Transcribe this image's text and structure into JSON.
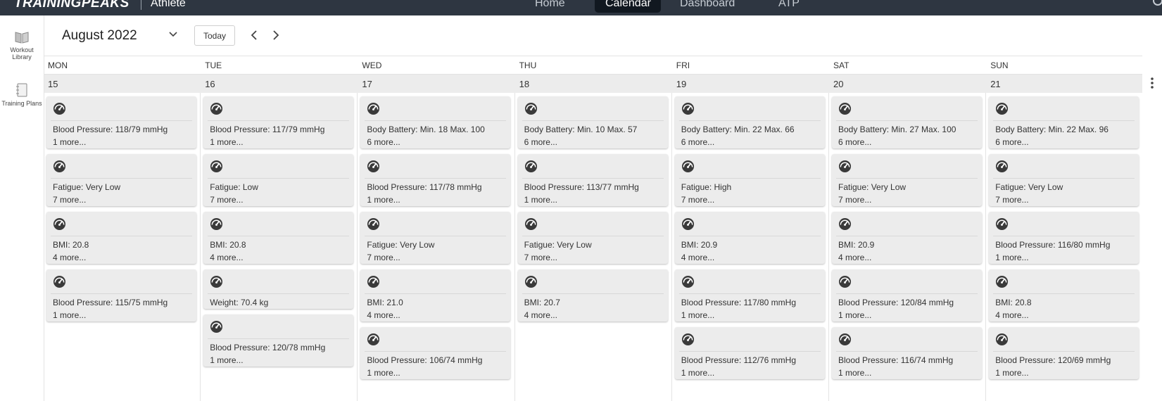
{
  "topnav": {
    "logo": "TRAININGPEAKS",
    "role": "Athlete",
    "items": [
      "Home",
      "Calendar",
      "Dashboard",
      "ATP"
    ],
    "active": "Calendar"
  },
  "rail": {
    "workout_library": "Workout Library",
    "training_plans": "Training Plans"
  },
  "toolbar": {
    "month": "August 2022",
    "today_label": "Today"
  },
  "calendar": {
    "days": [
      {
        "name": "MON",
        "date": "15",
        "cards": [
          {
            "title": "Blood Pressure: 118/79 mmHg",
            "more": "1 more..."
          },
          {
            "title": "Fatigue: Very Low",
            "more": "7 more..."
          },
          {
            "title": "BMI: 20.8",
            "more": "4 more..."
          },
          {
            "title": "Blood Pressure: 115/75 mmHg",
            "more": "1 more..."
          }
        ]
      },
      {
        "name": "TUE",
        "date": "16",
        "cards": [
          {
            "title": "Blood Pressure: 117/79 mmHg",
            "more": "1 more..."
          },
          {
            "title": "Fatigue: Low",
            "more": "7 more..."
          },
          {
            "title": "BMI: 20.8",
            "more": "4 more..."
          },
          {
            "title": "Weight: 70.4 kg",
            "more": ""
          },
          {
            "title": "Blood Pressure: 120/78 mmHg",
            "more": "1 more..."
          }
        ]
      },
      {
        "name": "WED",
        "date": "17",
        "cards": [
          {
            "title": "Body Battery: Min. 18 Max. 100",
            "more": "6 more..."
          },
          {
            "title": "Blood Pressure: 117/78 mmHg",
            "more": "1 more..."
          },
          {
            "title": "Fatigue: Very Low",
            "more": "7 more..."
          },
          {
            "title": "BMI: 21.0",
            "more": "4 more..."
          },
          {
            "title": "Blood Pressure: 106/74 mmHg",
            "more": "1 more..."
          }
        ]
      },
      {
        "name": "THU",
        "date": "18",
        "cards": [
          {
            "title": "Body Battery: Min. 10 Max. 57",
            "more": "6 more..."
          },
          {
            "title": "Blood Pressure: 113/77 mmHg",
            "more": "1 more..."
          },
          {
            "title": "Fatigue: Very Low",
            "more": "7 more..."
          },
          {
            "title": "BMI: 20.7",
            "more": "4 more..."
          }
        ]
      },
      {
        "name": "FRI",
        "date": "19",
        "cards": [
          {
            "title": "Body Battery: Min. 22 Max. 66",
            "more": "6 more..."
          },
          {
            "title": "Fatigue: High",
            "more": "7 more..."
          },
          {
            "title": "BMI: 20.9",
            "more": "4 more..."
          },
          {
            "title": "Blood Pressure: 117/80 mmHg",
            "more": "1 more..."
          },
          {
            "title": "Blood Pressure: 112/76 mmHg",
            "more": "1 more..."
          }
        ]
      },
      {
        "name": "SAT",
        "date": "20",
        "cards": [
          {
            "title": "Body Battery: Min. 27 Max. 100",
            "more": "6 more..."
          },
          {
            "title": "Fatigue: Very Low",
            "more": "7 more..."
          },
          {
            "title": "BMI: 20.9",
            "more": "4 more..."
          },
          {
            "title": "Blood Pressure: 120/84 mmHg",
            "more": "1 more..."
          },
          {
            "title": "Blood Pressure: 116/74 mmHg",
            "more": "1 more..."
          }
        ]
      },
      {
        "name": "SUN",
        "date": "21",
        "cards": [
          {
            "title": "Body Battery: Min. 22 Max. 96",
            "more": "6 more..."
          },
          {
            "title": "Fatigue: Very Low",
            "more": "7 more..."
          },
          {
            "title": "Blood Pressure: 116/80 mmHg",
            "more": "1 more..."
          },
          {
            "title": "BMI: 20.8",
            "more": "4 more..."
          },
          {
            "title": "Blood Pressure: 120/69 mmHg",
            "more": "1 more..."
          }
        ]
      }
    ]
  },
  "colors": {
    "topbar": "#2e3641",
    "card": "#ececec",
    "icon": "#3a3a3a"
  },
  "icons": {
    "card": "gauge-icon",
    "workout_library": "book-icon",
    "training_plans": "notebook-icon"
  }
}
